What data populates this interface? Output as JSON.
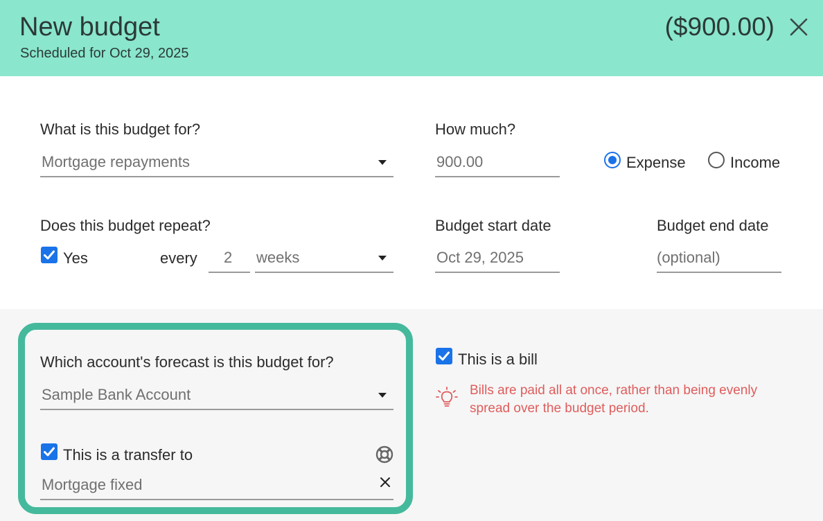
{
  "header": {
    "title": "New budget",
    "subtitle": "Scheduled for Oct 29, 2025",
    "amount": "($900.00)",
    "close_icon": "close-icon"
  },
  "purpose": {
    "label": "What is this budget for?",
    "value": "Mortgage repayments"
  },
  "amount": {
    "label": "How much?",
    "value": "900.00",
    "type_options": [
      {
        "label": "Expense",
        "selected": true
      },
      {
        "label": "Income",
        "selected": false
      }
    ]
  },
  "repeat": {
    "label": "Does this budget repeat?",
    "checkbox_label": "Yes",
    "checked": true,
    "every_label": "every",
    "interval": "2",
    "unit": "weeks"
  },
  "start_date": {
    "label": "Budget start date",
    "value": "Oct 29, 2025"
  },
  "end_date": {
    "label": "Budget end date",
    "placeholder": "(optional)"
  },
  "account": {
    "label": "Which account's forecast is this budget for?",
    "value": "Sample Bank Account"
  },
  "transfer": {
    "checkbox_label": "This is a transfer to",
    "checked": true,
    "value": "Mortgage fixed",
    "help_icon": "lifebuoy-icon",
    "clear_icon": "close-icon"
  },
  "bill": {
    "checkbox_label": "This is a bill",
    "checked": true,
    "tip_icon": "lightbulb-icon",
    "tip": "Bills are paid all at once, rather than being evenly spread over the budget period."
  },
  "colors": {
    "header_bg": "#8ae6cd",
    "accent": "#1a73e8",
    "card_border": "#45b99c",
    "tip_text": "#e05c5c"
  }
}
